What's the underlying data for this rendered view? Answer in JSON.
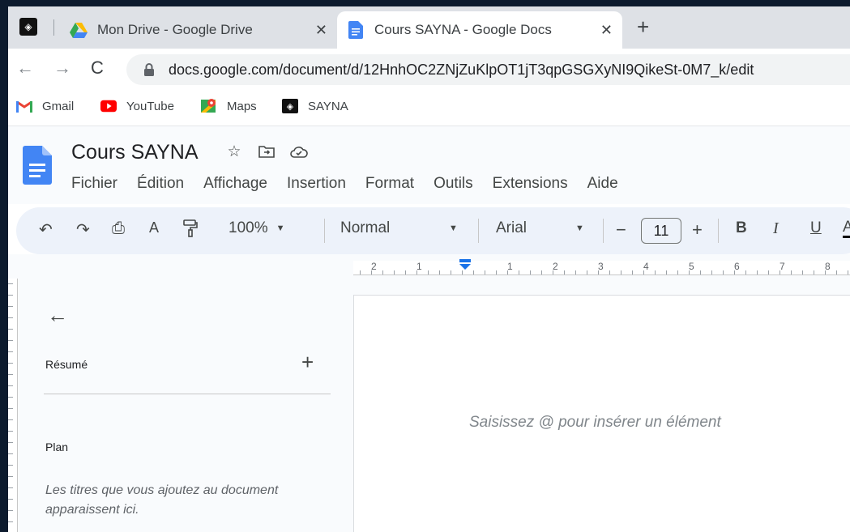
{
  "browser": {
    "app_icon_glyph": "◈",
    "tabs": [
      {
        "title": "Mon Drive - Google Drive",
        "icon": "drive-icon",
        "close": "✕"
      },
      {
        "title": "Cours SAYNA - Google Docs",
        "icon": "docs-icon",
        "close": "✕"
      }
    ],
    "new_tab": "+",
    "nav": {
      "back": "←",
      "forward": "→",
      "reload": "C"
    },
    "url": "docs.google.com/document/d/12HnhOC2ZNjZuKlpOT1jT3qpGSGXyNI9QikeSt-0M7_k/edit",
    "bookmarks": [
      {
        "label": "Gmail",
        "icon": "gmail-icon"
      },
      {
        "label": "YouTube",
        "icon": "youtube-icon"
      },
      {
        "label": "Maps",
        "icon": "maps-icon"
      },
      {
        "label": "SAYNA",
        "icon": "sayna-icon",
        "glyph": "◈"
      }
    ]
  },
  "docs": {
    "title": "Cours SAYNA",
    "menu": [
      "Fichier",
      "Édition",
      "Affichage",
      "Insertion",
      "Format",
      "Outils",
      "Extensions",
      "Aide"
    ],
    "toolbar": {
      "undo": "↶",
      "redo": "↷",
      "print": "⎙",
      "spellcheck": "A",
      "zoom": "100%",
      "style": "Normal",
      "font": "Arial",
      "decrease": "−",
      "font_size": "11",
      "increase": "+",
      "bold": "B",
      "italic": "I",
      "underline": "U",
      "text_color": "A"
    },
    "ruler_numbers": [
      "2",
      "1",
      "1",
      "2",
      "3",
      "4",
      "5",
      "6",
      "7",
      "8"
    ],
    "outline": {
      "back": "←",
      "summary_label": "Résumé",
      "summary_add": "+",
      "plan_label": "Plan",
      "plan_hint": "Les titres que vous ajoutez au document apparaissent ici."
    },
    "page_placeholder": "Saisissez @ pour insérer un élément"
  },
  "colors": {
    "tab_strip": "#dee1e6",
    "docs_blue": "#4285f4",
    "toolbar_bg": "#edf2fa",
    "ruler_marker": "#1a73e8"
  }
}
